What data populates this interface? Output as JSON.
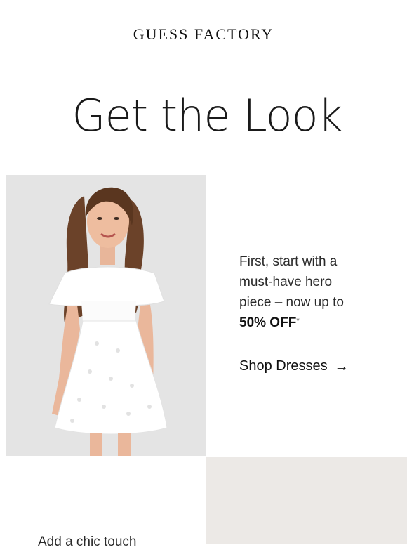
{
  "header": {
    "brand": "GUESS FACTORY"
  },
  "hero": {
    "headline": "Get the Look"
  },
  "feature": {
    "lines": [
      "First, start with a",
      "must-have hero",
      "piece – now up to"
    ],
    "offer": "50% OFF",
    "asterisk": "*",
    "cta_label": "Shop Dresses",
    "cta_arrow": "→"
  },
  "next_feature": {
    "text": "Add a chic touch"
  },
  "icons": {
    "cta_arrow": "arrow-right-icon"
  },
  "colors": {
    "background": "#ffffff",
    "photo_background": "#e6e6e6",
    "text": "#1a1a1a"
  }
}
